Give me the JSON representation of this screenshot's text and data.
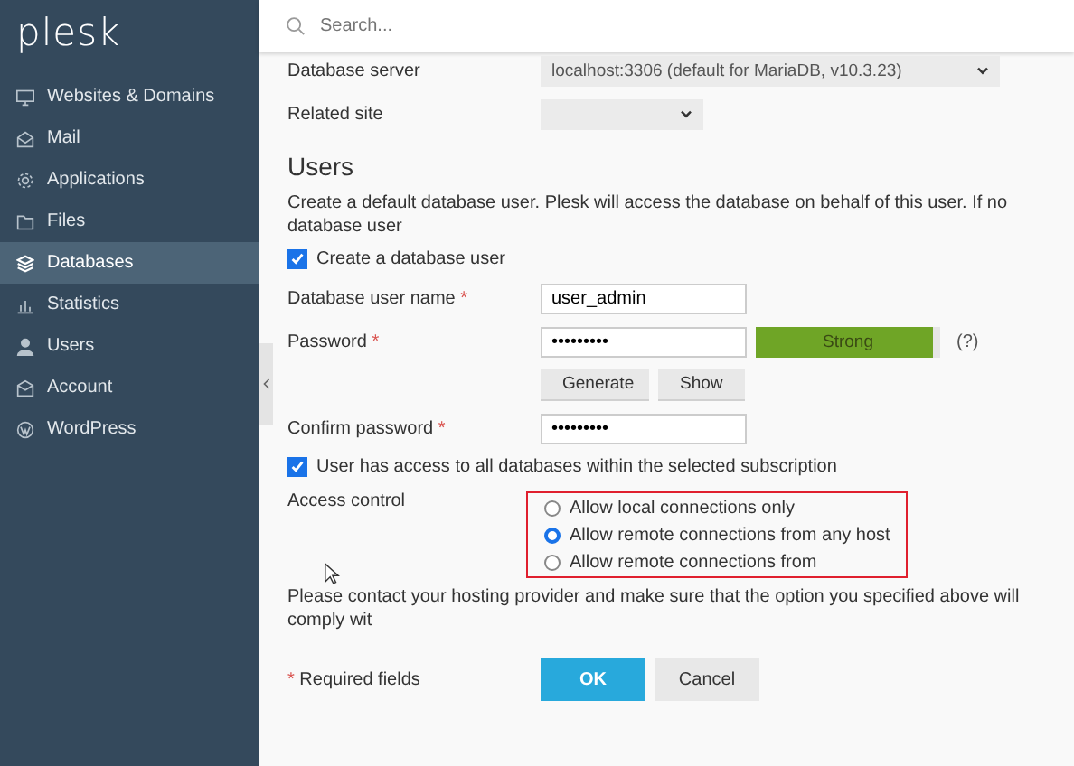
{
  "sidebar": {
    "logo": "plesk",
    "items": [
      {
        "label": "Websites & Domains",
        "kind": "monitor",
        "selected": false
      },
      {
        "label": "Mail",
        "kind": "mail",
        "selected": false
      },
      {
        "label": "Applications",
        "kind": "gear",
        "selected": false
      },
      {
        "label": "Files",
        "kind": "folder",
        "selected": false
      },
      {
        "label": "Databases",
        "kind": "layers",
        "selected": true
      },
      {
        "label": "Statistics",
        "kind": "chart",
        "selected": false
      },
      {
        "label": "Users",
        "kind": "user",
        "selected": false
      },
      {
        "label": "Account",
        "kind": "account",
        "selected": false
      },
      {
        "label": "WordPress",
        "kind": "wordpress",
        "selected": false
      }
    ]
  },
  "search": {
    "placeholder": "Search..."
  },
  "server": {
    "label": "Database server",
    "value": "localhost:3306 (default for MariaDB, v10.3.23)"
  },
  "related_site": {
    "label": "Related site"
  },
  "users": {
    "heading": "Users",
    "description": "Create a default database user. Plesk will access the database on behalf of this user. If no database user",
    "create_user": {
      "label": "Create a database user",
      "checked": true
    },
    "user_name": {
      "label": "Database user name",
      "required_mark": "*",
      "value": "user_admin"
    },
    "password": {
      "label": "Password",
      "required_mark": "*",
      "value": "•••••••••",
      "strength": "Strong",
      "level": 0.96,
      "help": "(?)"
    },
    "password_buttons": [
      "Generate",
      "Show"
    ],
    "confirm": {
      "label": "Confirm password",
      "required_mark": "*",
      "value": "•••••••••"
    },
    "all_databases": {
      "label": "User has access to all databases within the selected subscription",
      "checked": true
    },
    "access_control": {
      "label": "Access control",
      "options": [
        {
          "label": "Allow local connections only",
          "selected": false
        },
        {
          "label": "Allow remote connections from any host",
          "selected": true
        },
        {
          "label": "Allow remote connections from",
          "selected": false
        }
      ]
    },
    "notice": "Please contact your hosting provider and make sure that the option you specified above will comply wit"
  },
  "footer": {
    "required_note": "* Required fields",
    "buttons": [
      {
        "label": "OK",
        "kind": "primary"
      },
      {
        "label": "Cancel",
        "kind": "secondary"
      }
    ]
  }
}
